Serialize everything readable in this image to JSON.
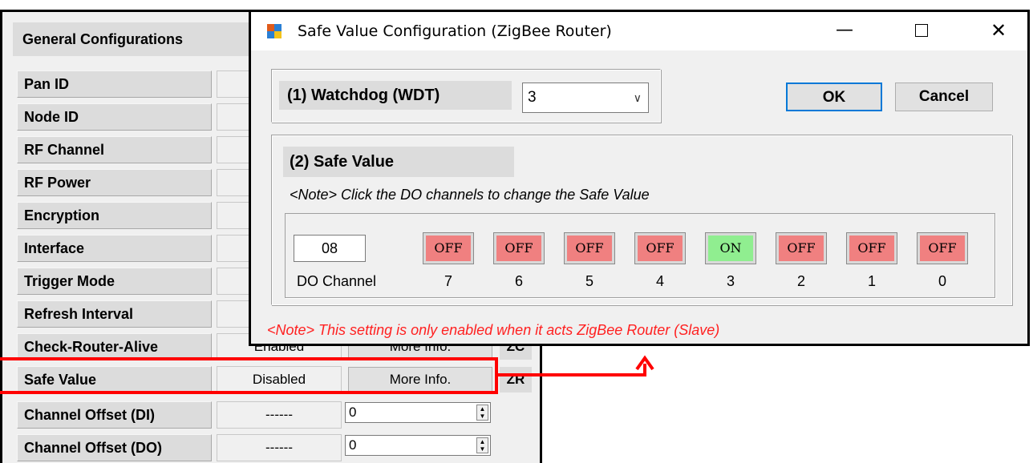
{
  "general": {
    "title": "General Configurations",
    "rows": [
      {
        "label": "Pan ID"
      },
      {
        "label": "Node ID"
      },
      {
        "label": "RF Channel"
      },
      {
        "label": "RF Power"
      },
      {
        "label": "Encryption"
      },
      {
        "label": "Interface"
      },
      {
        "label": "Trigger Mode"
      },
      {
        "label": "Refresh Interval"
      },
      {
        "label": "Check-Router-Alive",
        "value": "Enabled",
        "button": "More Info.",
        "role": "ZC"
      },
      {
        "label": "Safe Value",
        "value": "Disabled",
        "button": "More Info.",
        "role": "ZR"
      },
      {
        "label": "Channel Offset (DI)",
        "value": "------",
        "spin": "0"
      },
      {
        "label": "Channel Offset (DO)",
        "value": "------",
        "spin": "0"
      }
    ]
  },
  "dialog": {
    "title": "Safe Value Configuration (ZigBee Router)",
    "minimize": "—",
    "close": "✕",
    "watchdog": {
      "label": "(1) Watchdog (WDT)",
      "value": "3"
    },
    "ok_label": "OK",
    "cancel_label": "Cancel",
    "safe_value": {
      "label": "(2) Safe Value",
      "note": "<Note> Click the DO channels to change the Safe Value",
      "value": "08",
      "channel_label": "DO Channel",
      "channels": [
        {
          "num": "7",
          "state": "OFF"
        },
        {
          "num": "6",
          "state": "OFF"
        },
        {
          "num": "5",
          "state": "OFF"
        },
        {
          "num": "4",
          "state": "OFF"
        },
        {
          "num": "3",
          "state": "ON"
        },
        {
          "num": "2",
          "state": "OFF"
        },
        {
          "num": "1",
          "state": "OFF"
        },
        {
          "num": "0",
          "state": "OFF"
        }
      ]
    },
    "router_note": "<Note> This setting is only enabled when it acts ZigBee Router (Slave)"
  },
  "colors": {
    "off": "#f08080",
    "on": "#90ee90",
    "highlight": "#ff0000",
    "note_red": "#ff2020"
  }
}
